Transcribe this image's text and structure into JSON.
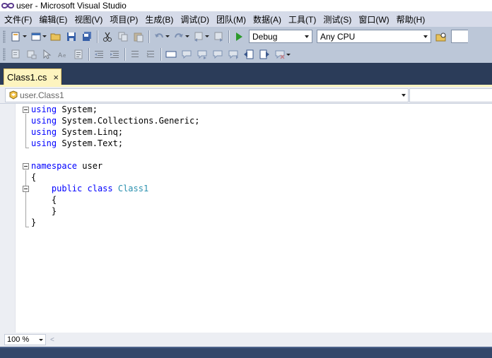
{
  "window": {
    "title": "user - Microsoft Visual Studio"
  },
  "menu": [
    "文件(F)",
    "编辑(E)",
    "视图(V)",
    "项目(P)",
    "生成(B)",
    "调试(D)",
    "团队(M)",
    "数据(A)",
    "工具(T)",
    "测试(S)",
    "窗口(W)",
    "帮助(H)"
  ],
  "toolbar": {
    "config": "Debug",
    "platform": "Any CPU",
    "icons_row1": [
      "new-project-icon",
      "add-item-icon",
      "open-file-icon",
      "save-icon",
      "save-all-icon",
      "cut-icon",
      "copy-icon",
      "paste-icon",
      "undo-icon",
      "redo-icon",
      "navigate-backward-icon",
      "navigate-forward-icon",
      "start-debugging-icon",
      "find-in-files-icon"
    ],
    "icons_row2": [
      "member-list-icon",
      "parameter-info-icon",
      "quick-info-icon",
      "word-completion-icon",
      "format-icon",
      "decrease-indent-icon",
      "increase-indent-icon",
      "comment-icon",
      "uncomment-icon",
      "bookmark-icon",
      "prev-bookmark-icon",
      "next-bookmark-icon",
      "prev-bookmark-folder-icon",
      "next-bookmark-folder-icon",
      "clear-bookmarks-icon",
      "overflow-icon"
    ]
  },
  "tab": {
    "name": "Class1.cs",
    "close": "×"
  },
  "navigation": {
    "type_selector": "user.Class1"
  },
  "code": {
    "lines": [
      [
        {
          "t": "using",
          "k": "kw"
        },
        {
          "t": " System;",
          "k": ""
        }
      ],
      [
        {
          "t": "using",
          "k": "kw"
        },
        {
          "t": " System.Collections.Generic;",
          "k": ""
        }
      ],
      [
        {
          "t": "using",
          "k": "kw"
        },
        {
          "t": " System.Linq;",
          "k": ""
        }
      ],
      [
        {
          "t": "using",
          "k": "kw"
        },
        {
          "t": " System.Text;",
          "k": ""
        }
      ],
      [],
      [
        {
          "t": "namespace",
          "k": "kw"
        },
        {
          "t": " user",
          "k": ""
        }
      ],
      [
        {
          "t": "{",
          "k": ""
        }
      ],
      [
        {
          "t": "    ",
          "k": ""
        },
        {
          "t": "public",
          "k": "kw"
        },
        {
          "t": " ",
          "k": ""
        },
        {
          "t": "class",
          "k": "kw"
        },
        {
          "t": " ",
          "k": ""
        },
        {
          "t": "Class1",
          "k": "typ"
        }
      ],
      [
        {
          "t": "    {",
          "k": ""
        }
      ],
      [
        {
          "t": "    }",
          "k": ""
        }
      ],
      [
        {
          "t": "}",
          "k": ""
        }
      ]
    ]
  },
  "status": {
    "zoom": "100 %",
    "scroll_left": "<"
  },
  "colors": {
    "accent_tab": "#fdf4bf",
    "chrome": "#2b3c59",
    "keyword": "#0000ff",
    "type": "#2b91af"
  }
}
